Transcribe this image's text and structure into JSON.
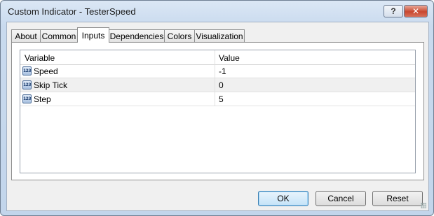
{
  "window": {
    "title": "Custom Indicator - TesterSpeed",
    "help_label": "?",
    "close_label": "✕"
  },
  "tabs": [
    {
      "label": "About"
    },
    {
      "label": "Common"
    },
    {
      "label": "Inputs",
      "active": true
    },
    {
      "label": "Dependencies"
    },
    {
      "label": "Colors"
    },
    {
      "label": "Visualization"
    }
  ],
  "table": {
    "headers": {
      "variable": "Variable",
      "value": "Value"
    },
    "icon_text": "123",
    "rows": [
      {
        "variable": "Speed",
        "value": "-1"
      },
      {
        "variable": "Skip Tick",
        "value": "0"
      },
      {
        "variable": "Step",
        "value": "5"
      }
    ]
  },
  "buttons": {
    "ok": "OK",
    "cancel": "Cancel",
    "reset": "Reset"
  }
}
